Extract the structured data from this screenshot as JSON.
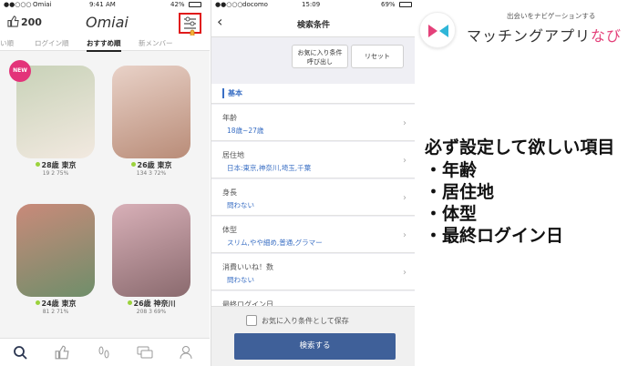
{
  "left_phone": {
    "status": {
      "carrier": "Omiai",
      "time": "9:41 AM",
      "battery": "42%"
    },
    "like_count": "200",
    "logo": "Omiai",
    "tabs": [
      "い順",
      "ログイン順",
      "おすすめ順",
      "新メンバー"
    ],
    "new_badge": "NEW",
    "profiles": [
      {
        "name": "28歳 東京",
        "stats": "19  2  75%",
        "colors": [
          "#c8d2b8",
          "#f2e9e0"
        ]
      },
      {
        "name": "26歳 東京",
        "stats": "134  3  72%",
        "colors": [
          "#e9d2c8",
          "#b98c78"
        ]
      },
      {
        "name": "24歳 東京",
        "stats": "81  2  71%",
        "colors": [
          "#c98a7a",
          "#6f8e6a"
        ]
      },
      {
        "name": "26歳 神奈川",
        "stats": "208  3  69%",
        "colors": [
          "#d8b0b8",
          "#8a6a6e"
        ]
      }
    ],
    "nav_icons": [
      "search-icon",
      "thumb-up-icon",
      "footprints-icon",
      "chat-icon",
      "person-icon"
    ]
  },
  "mid_phone": {
    "status": {
      "carrier": "docomo",
      "time": "15:09",
      "battery": "69%"
    },
    "title": "検索条件",
    "buttons": {
      "favorite_load": "お気に入り条件\n呼び出し",
      "reset": "リセット"
    },
    "section": "基本",
    "rows": [
      {
        "label": "年齢",
        "value": "18歳~27歳"
      },
      {
        "label": "居住地",
        "value": "日本:東京,神奈川,埼玉,千葉"
      },
      {
        "label": "身長",
        "value": "問わない"
      },
      {
        "label": "体型",
        "value": "スリム,やや細め,普通,グラマー"
      },
      {
        "label": "消費いいね！数",
        "value": "問わない"
      },
      {
        "label": "最終ログイン日",
        "value": ""
      }
    ],
    "save_label": "お気に入り条件として保存",
    "search_label": "検索する"
  },
  "brand": {
    "tagline": "出会いをナビゲーションする",
    "name_main": "マッチングアプリ",
    "name_accent": "なび"
  },
  "checklist": {
    "heading": "必ず設定して欲しい項目",
    "items": [
      "・年齢",
      "・居住地",
      "・体型",
      "・最終ログイン日"
    ]
  },
  "colors": {
    "accent_pink": "#e3337a",
    "search_button": "#3f6099",
    "link_blue": "#3a6fc4",
    "highlight_red": "#e01b1b"
  }
}
